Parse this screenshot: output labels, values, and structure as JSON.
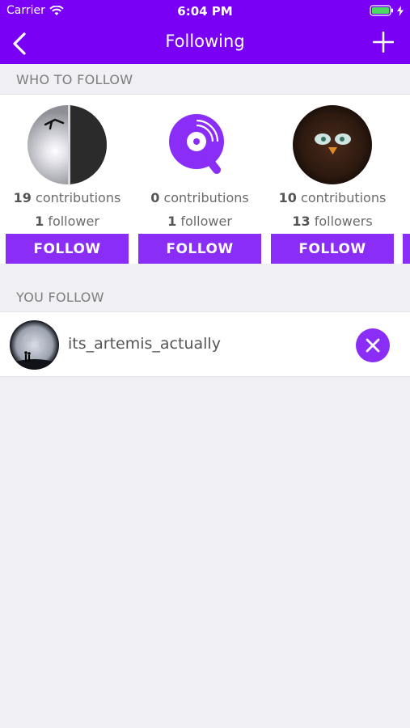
{
  "status_bar": {
    "carrier": "Carrier",
    "time": "6:04 PM"
  },
  "nav": {
    "title": "Following"
  },
  "who_to_follow": {
    "header": "WHO TO FOLLOW",
    "cards": [
      {
        "contrib_count": "19",
        "contrib_label": "contributions",
        "follower_count": "1",
        "follower_label": "follower",
        "button": "FOLLOW",
        "avatar": "photo-avatar"
      },
      {
        "contrib_count": "0",
        "contrib_label": "contributions",
        "follower_count": "1",
        "follower_label": "follower",
        "button": "FOLLOW",
        "avatar": "app-logo-avatar"
      },
      {
        "contrib_count": "10",
        "contrib_label": "contributions",
        "follower_count": "13",
        "follower_label": "followers",
        "button": "FOLLOW",
        "avatar": "furby-avatar"
      }
    ]
  },
  "you_follow": {
    "header": "YOU FOLLOW",
    "items": [
      {
        "username": "its_artemis_actually",
        "avatar": "moon-avatar"
      }
    ]
  },
  "colors": {
    "accent": "#7a00f5",
    "button": "#8a2df7",
    "background": "#efeff4"
  }
}
